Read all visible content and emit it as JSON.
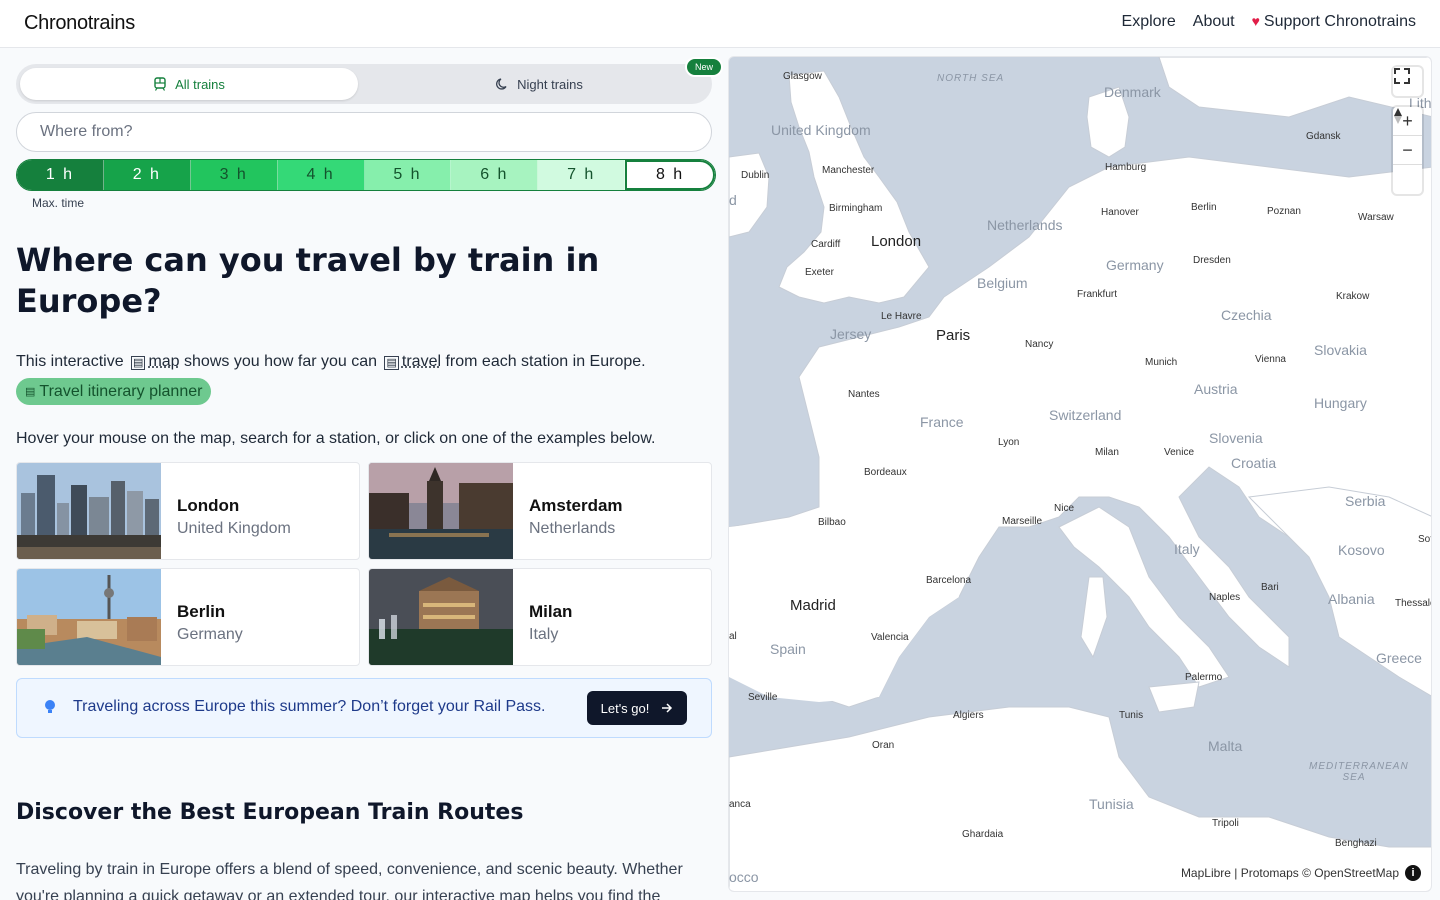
{
  "header": {
    "brand": "Chronotrains",
    "nav": [
      "Explore",
      "About",
      "Support Chronotrains"
    ]
  },
  "mode_toggle": {
    "all_trains": "All trains",
    "night_trains": "Night trains",
    "new_badge": "New"
  },
  "search": {
    "placeholder": "Where from?"
  },
  "time_selector": {
    "options": [
      "1 h",
      "2 h",
      "3 h",
      "4 h",
      "5 h",
      "6 h",
      "7 h",
      "8 h"
    ],
    "selected": "8 h",
    "label": "Max. time",
    "colors": [
      "#15803d",
      "#16a34a",
      "#22c55e",
      "#34d977",
      "#86efac",
      "#a7f3c0",
      "#d1fae0",
      "#ffffff"
    ]
  },
  "hero": {
    "title": "Where can you travel by train in Europe?",
    "intro_prefix": "This interactive",
    "intro_map": "map",
    "intro_middle": "shows you how far you can",
    "intro_travel": "travel",
    "intro_suffix": "from each station in Europe.",
    "planner_tag": "Travel itinerary planner",
    "hint": "Hover your mouse on the map, search for a station, or click on one of the examples below."
  },
  "examples": [
    {
      "city": "London",
      "country": "United Kingdom"
    },
    {
      "city": "Amsterdam",
      "country": "Netherlands"
    },
    {
      "city": "Berlin",
      "country": "Germany"
    },
    {
      "city": "Milan",
      "country": "Italy"
    }
  ],
  "promo": {
    "text": "Traveling across Europe this summer? Don’t forget your Rail Pass.",
    "button": "Let's go!"
  },
  "discover": {
    "heading": "Discover the Best European Train Routes",
    "paragraph": "Traveling by train in Europe offers a blend of speed, convenience, and scenic beauty. Whether you're planning a quick getaway or an extended tour, our interactive map helps you find the"
  },
  "map": {
    "attribution": "MapLibre | Protomaps © OpenStreetMap",
    "cities": [
      "Glasgow",
      "Denmark",
      "United Kingdom",
      "Gdansk",
      "Dublin",
      "Manchester",
      "Hamburg",
      "Birmingham",
      "Hanover",
      "Berlin",
      "Poznan",
      "Warsaw",
      "Netherlands",
      "Cardiff",
      "London",
      "Germany",
      "Dresden",
      "Exeter",
      "Belgium",
      "Frankfurt",
      "Krakow",
      "Le Havre",
      "Jersey",
      "Paris",
      "Czechia",
      "Nancy",
      "Slovakia",
      "Munich",
      "Vienna",
      "Nantes",
      "Austria",
      "Hungary",
      "France",
      "Switzerland",
      "Lyon",
      "Slovenia",
      "Milan",
      "Venice",
      "Croatia",
      "Bordeaux",
      "Serbia",
      "Bilbao",
      "Marseille",
      "Nice",
      "Italy",
      "Kosovo",
      "Barcelona",
      "Bari",
      "Madrid",
      "Naples",
      "Albania",
      "Thessalo",
      "Valencia",
      "Spain",
      "Greece",
      "Palermo",
      "Seville",
      "Algiers",
      "Tunis",
      "Oran",
      "Malta",
      "Tunisia",
      "Tripoli",
      "Ghardaia",
      "Benghazi",
      "NORTH SEA",
      "MEDITERRANEAN SEA",
      "Lith",
      "Sof",
      "anca",
      "occo",
      "al",
      "d"
    ]
  }
}
